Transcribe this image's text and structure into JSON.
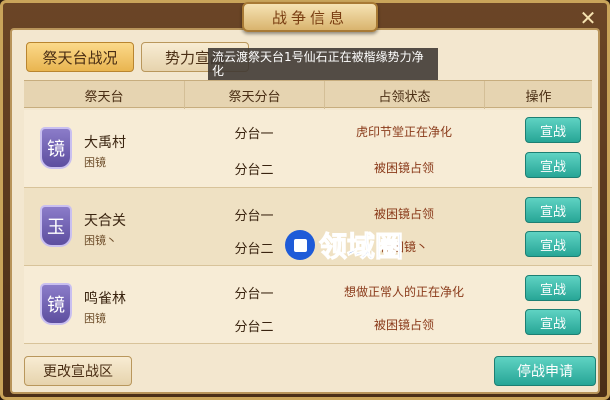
{
  "window": {
    "title": "战争信息",
    "close_glyph": "✕"
  },
  "tabs": [
    {
      "label": "祭天台战况",
      "active": true
    },
    {
      "label": "势力宣战",
      "active": false
    }
  ],
  "tooltip": "流云渡祭天台1号仙石正在被楷缘势力净化",
  "table": {
    "headers": [
      "祭天台",
      "祭天分台",
      "占领状态",
      "操作"
    ],
    "groups": [
      {
        "badge": "镜",
        "name": "大禹村",
        "sub": "困镜",
        "rows": [
          {
            "sub_altar": "分台一",
            "status": "虎印节堂正在净化",
            "action": "宣战"
          },
          {
            "sub_altar": "分台二",
            "status": "被困镜占领",
            "action": "宣战"
          }
        ]
      },
      {
        "badge": "玉",
        "name": "天合关",
        "sub": "困镜丶",
        "rows": [
          {
            "sub_altar": "分台一",
            "status": "被困镜占领",
            "action": "宣战"
          },
          {
            "sub_altar": "分台二",
            "status": "被困镜丶",
            "action": "宣战"
          }
        ]
      },
      {
        "badge": "镜",
        "name": "鸣雀林",
        "sub": "困镜",
        "rows": [
          {
            "sub_altar": "分台一",
            "status": "想做正常人的正在净化",
            "action": "宣战"
          },
          {
            "sub_altar": "分台二",
            "status": "被困镜占领",
            "action": "宣战"
          }
        ]
      }
    ]
  },
  "footer": {
    "change_label": "更改宣战区",
    "stop_label": "停战申请"
  },
  "watermark": {
    "text": "领域圈"
  },
  "colors": {
    "accent_teal": "#27a596",
    "badge_purple": "#6b5cb0",
    "status_red": "#8a3a1a"
  }
}
